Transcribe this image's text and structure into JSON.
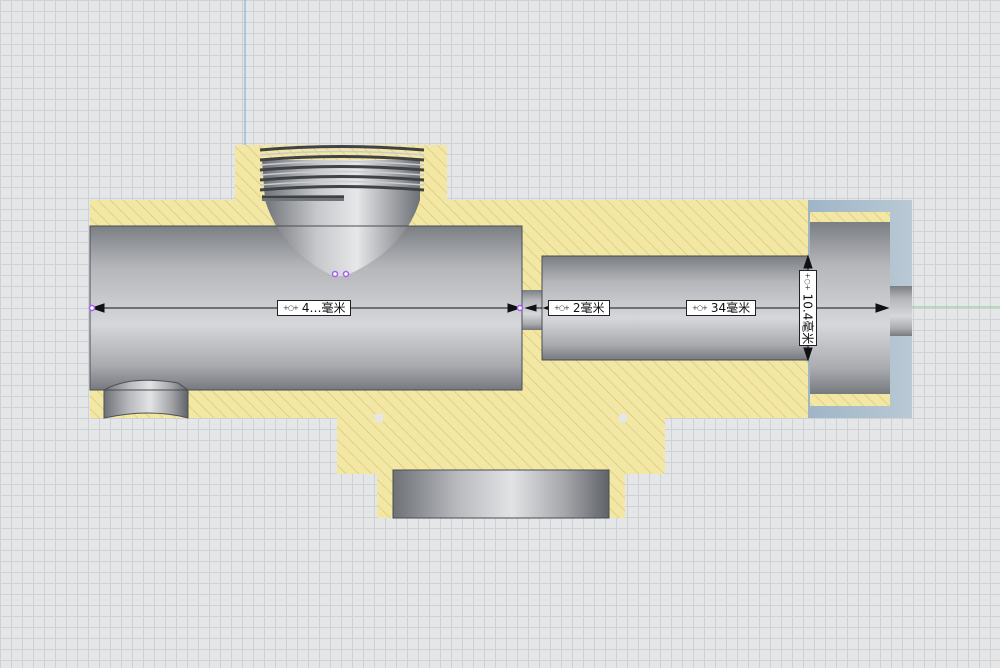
{
  "drawing": {
    "dimensions": [
      {
        "id": "dim-a",
        "label": "4…毫米"
      },
      {
        "id": "dim-b",
        "label": "2毫米"
      },
      {
        "id": "dim-c",
        "label": "34毫米"
      },
      {
        "id": "dim-d",
        "label": "10.4毫米"
      }
    ],
    "colors": {
      "section_fill": "#f3e7a6",
      "hatch": "#d8c770",
      "bore_dark": "#8a8d91",
      "bore_light": "#dcdde0",
      "cap_blue": "#a8bccb",
      "guide_blue": "#7aa6d8",
      "guide_green": "#7fcf8f",
      "marker": "#a65cf0"
    }
  }
}
